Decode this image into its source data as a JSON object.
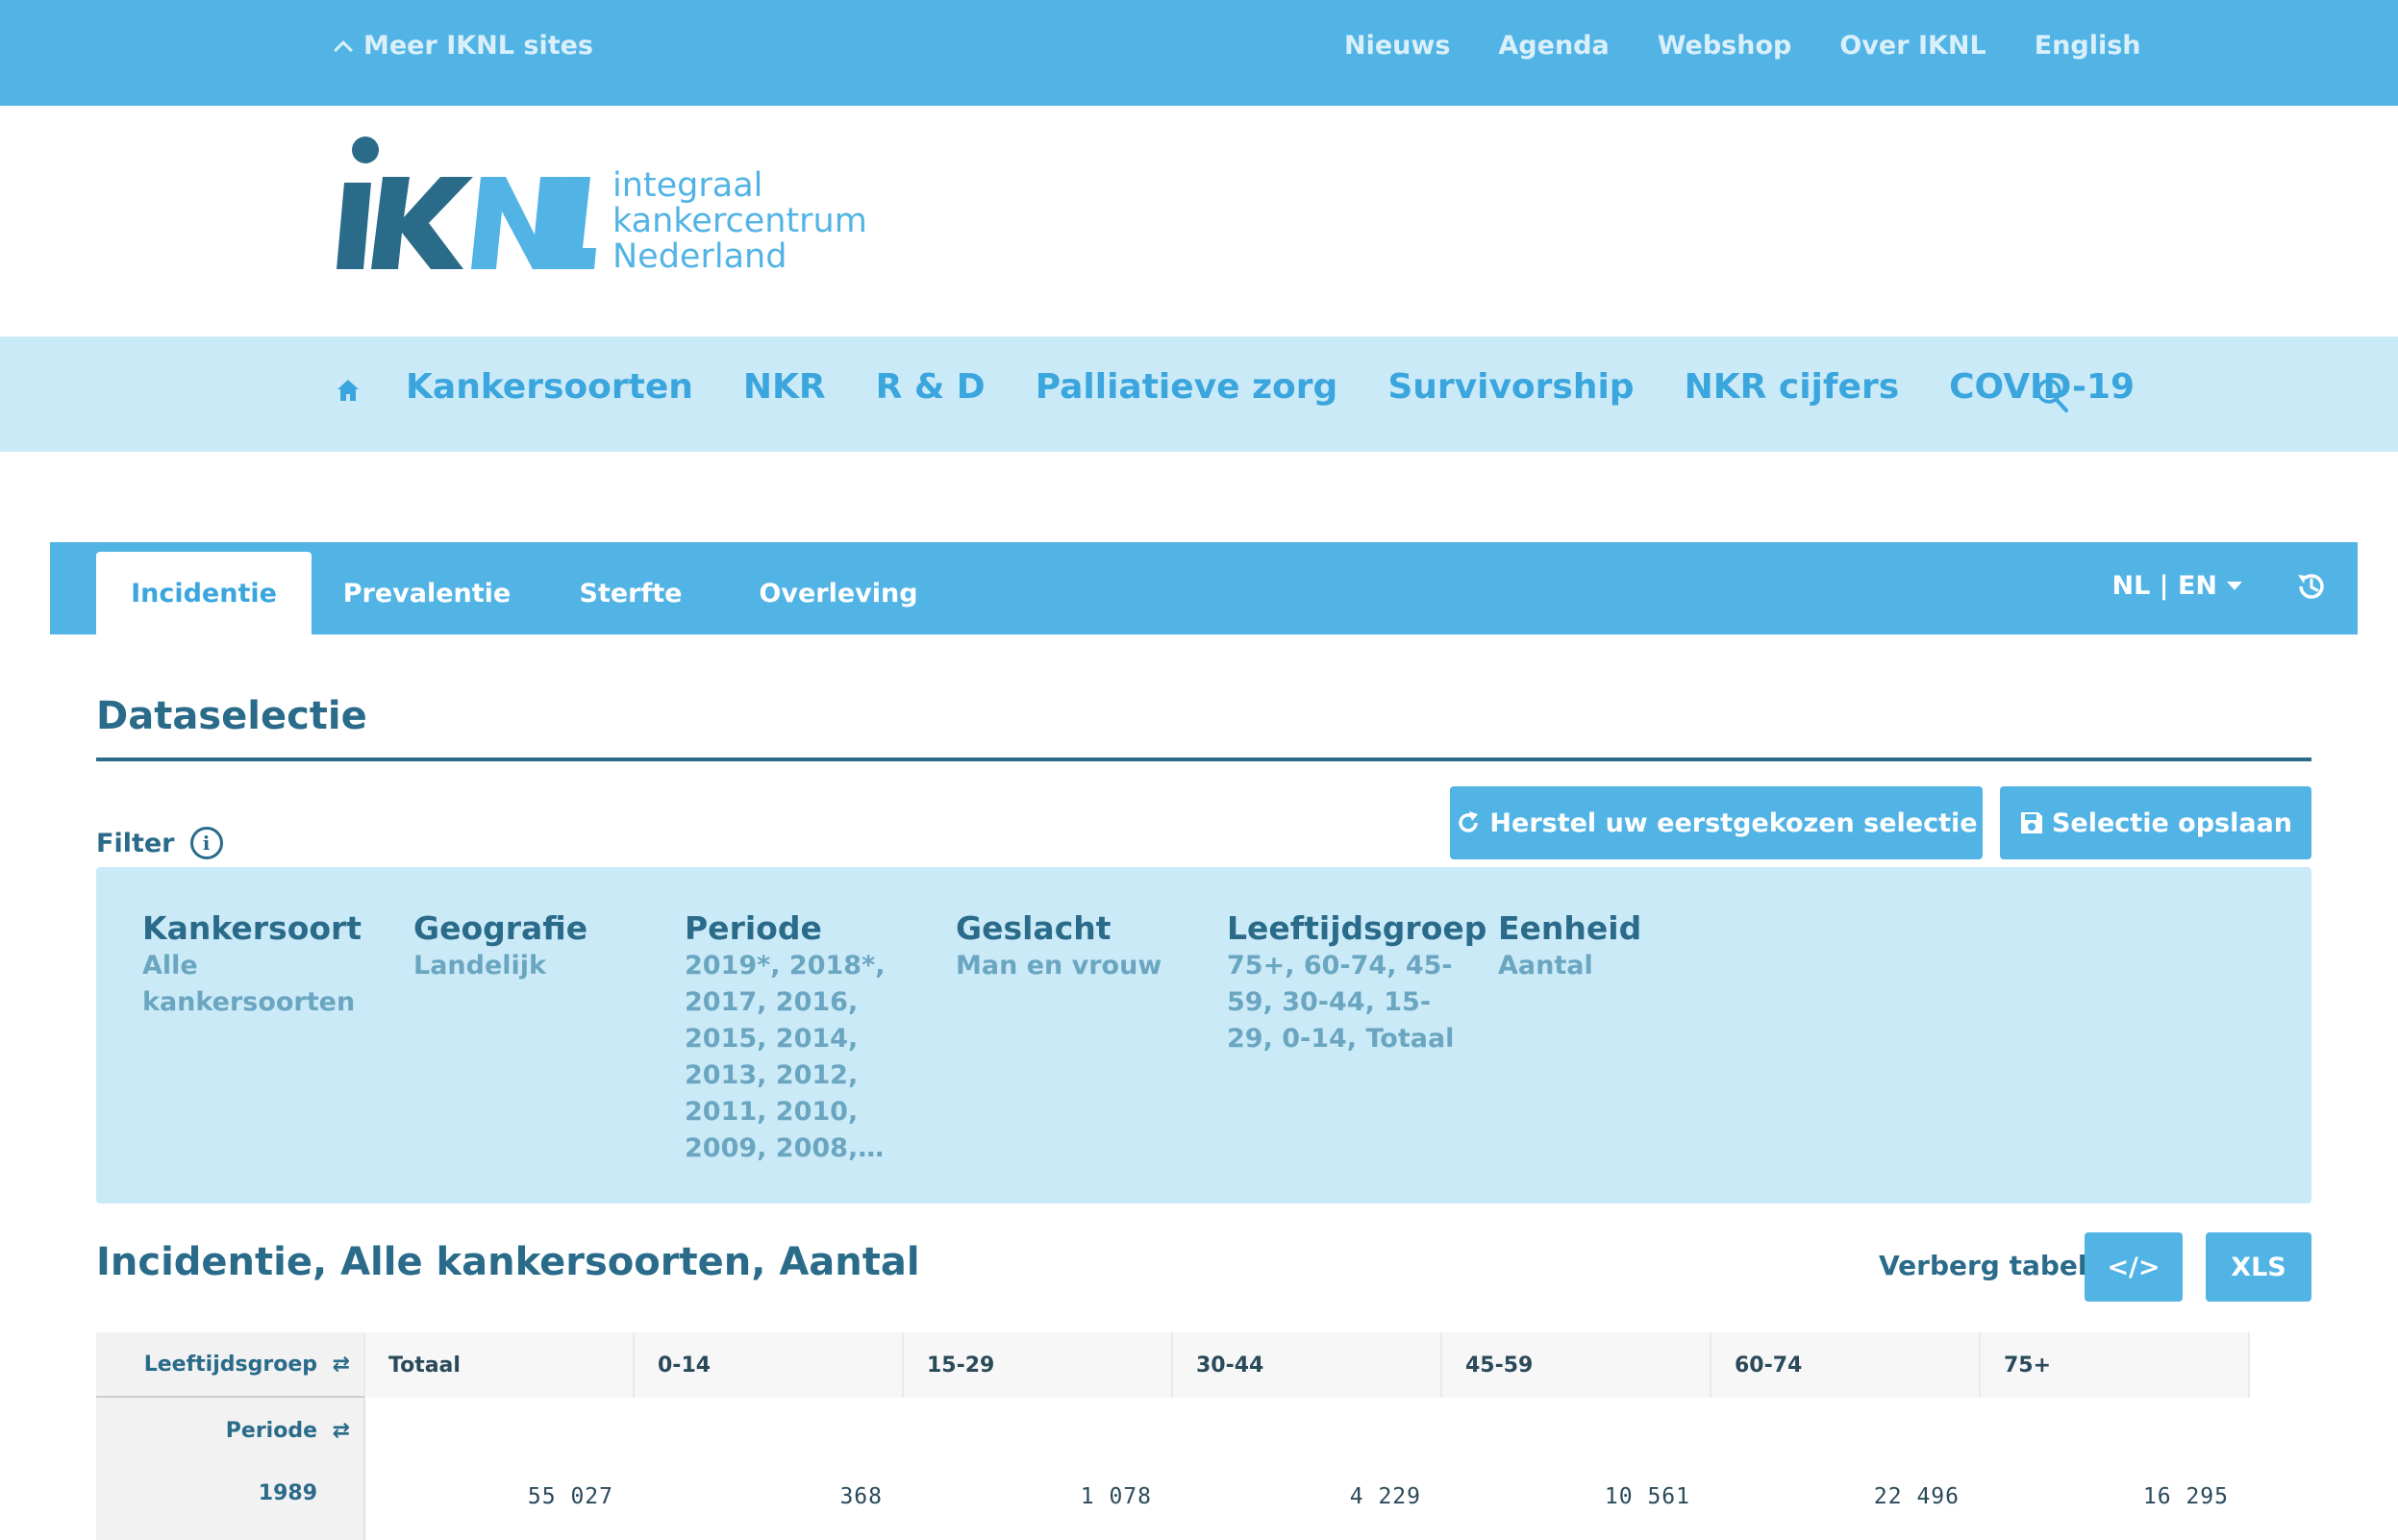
{
  "topbar": {
    "meer": "Meer IKNL sites",
    "links": [
      "Nieuws",
      "Agenda",
      "Webshop",
      "Over IKNL",
      "English"
    ]
  },
  "logo": {
    "mark": "iKNL",
    "line1": "integraal",
    "line2": "kankercentrum",
    "line3": "Nederland"
  },
  "mainnav": {
    "items": [
      "Kankersoorten",
      "NKR",
      "R & D",
      "Palliatieve zorg",
      "Survivorship",
      "NKR cijfers",
      "COVID-19"
    ]
  },
  "tabs": [
    "Incidentie",
    "Prevalentie",
    "Sterfte",
    "Overleving"
  ],
  "language": "NL | EN",
  "dataselectie": {
    "title": "Dataselectie",
    "filter_label": "Filter",
    "info": "i",
    "herstel": "Herstel uw eerstgekozen selectie",
    "opslaan": "Selectie opslaan",
    "filters": [
      {
        "title": "Kankersoort",
        "value": "Alle kankersoorten"
      },
      {
        "title": "Geografie",
        "value": "Landelijk"
      },
      {
        "title": "Periode",
        "value": "2019*, 2018*, 2017, 2016, 2015, 2014, 2013, 2012, 2011, 2010, 2009, 2008,…"
      },
      {
        "title": "Geslacht",
        "value": "Man en vrouw"
      },
      {
        "title": "Leeftijdsgroep",
        "value": "75+, 60-74, 45-59, 30-44, 15-29, 0-14, Totaal"
      },
      {
        "title": "Eenheid",
        "value": "Aantal"
      }
    ]
  },
  "results": {
    "title": "Incidentie, Alle kankersoorten, Aantal",
    "verberg": "Verberg tabel",
    "code_btn": "</>",
    "xls_btn": "XLS"
  },
  "table": {
    "corner_col": "Leeftijdsgroep",
    "corner_row": "Periode",
    "columns": [
      "Totaal",
      "0-14",
      "15-29",
      "30-44",
      "45-59",
      "60-74",
      "75+"
    ],
    "rows": [
      {
        "label": "1989",
        "values": [
          "55 027",
          "368",
          "1 078",
          "4 229",
          "10 561",
          "22 496",
          "16 295"
        ]
      }
    ]
  },
  "colors": {
    "topbar": "#52b3e5",
    "nav": "#cbeaf8",
    "dark": "#2a6b8a"
  }
}
